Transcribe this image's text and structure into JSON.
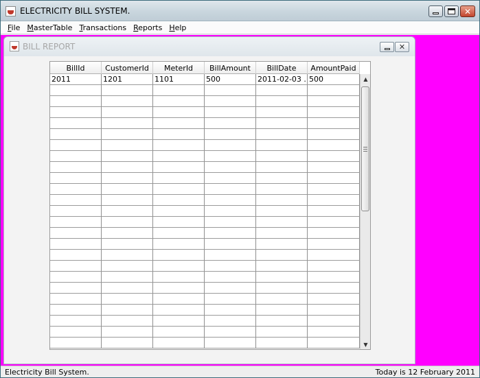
{
  "window": {
    "title": "ELECTRICITY BILL SYSTEM."
  },
  "menu": [
    "File",
    "MasterTable",
    "Transactions",
    "Reports",
    "Help"
  ],
  "menu_mnemonics": [
    "F",
    "M",
    "T",
    "R",
    "H"
  ],
  "internal_frame": {
    "title": "BILL REPORT"
  },
  "table": {
    "columns": [
      "BillId",
      "CustomerId",
      "MeterId",
      "BillAmount",
      "BillDate",
      "AmountPaid"
    ],
    "rows": [
      [
        "2011",
        "1201",
        "1101",
        "500",
        "2011-02-03 ...",
        "500"
      ]
    ],
    "visible_empty_rows": 24
  },
  "status": {
    "left": "Electricity Bill System.",
    "right": "Today is 12 February 2011"
  },
  "colors": {
    "desktop_background": "#ff00ff"
  },
  "icons": {
    "app": "java-coffee-cup-icon",
    "frame": "java-coffee-cup-icon"
  }
}
